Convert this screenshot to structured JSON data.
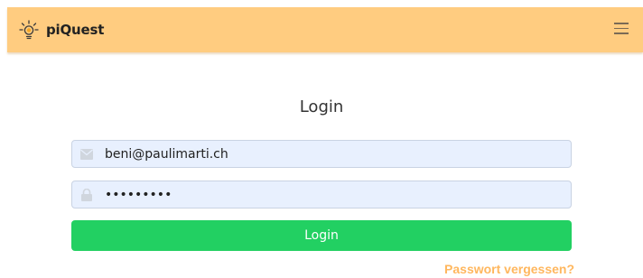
{
  "app": {
    "name": "piQuest"
  },
  "navbar": {
    "background": "#ffcc80",
    "menu_icon": "hamburger-menu-icon"
  },
  "login": {
    "title": "Login",
    "email": {
      "value": "beni@paulimarti.ch",
      "icon": "envelope-icon"
    },
    "password": {
      "value": "•••••••••",
      "icon": "lock-icon"
    },
    "submit_label": "Login",
    "submit_color": "#22d062",
    "forgot_label": "Passwort vergessen?",
    "forgot_color": "#ffb75e"
  }
}
